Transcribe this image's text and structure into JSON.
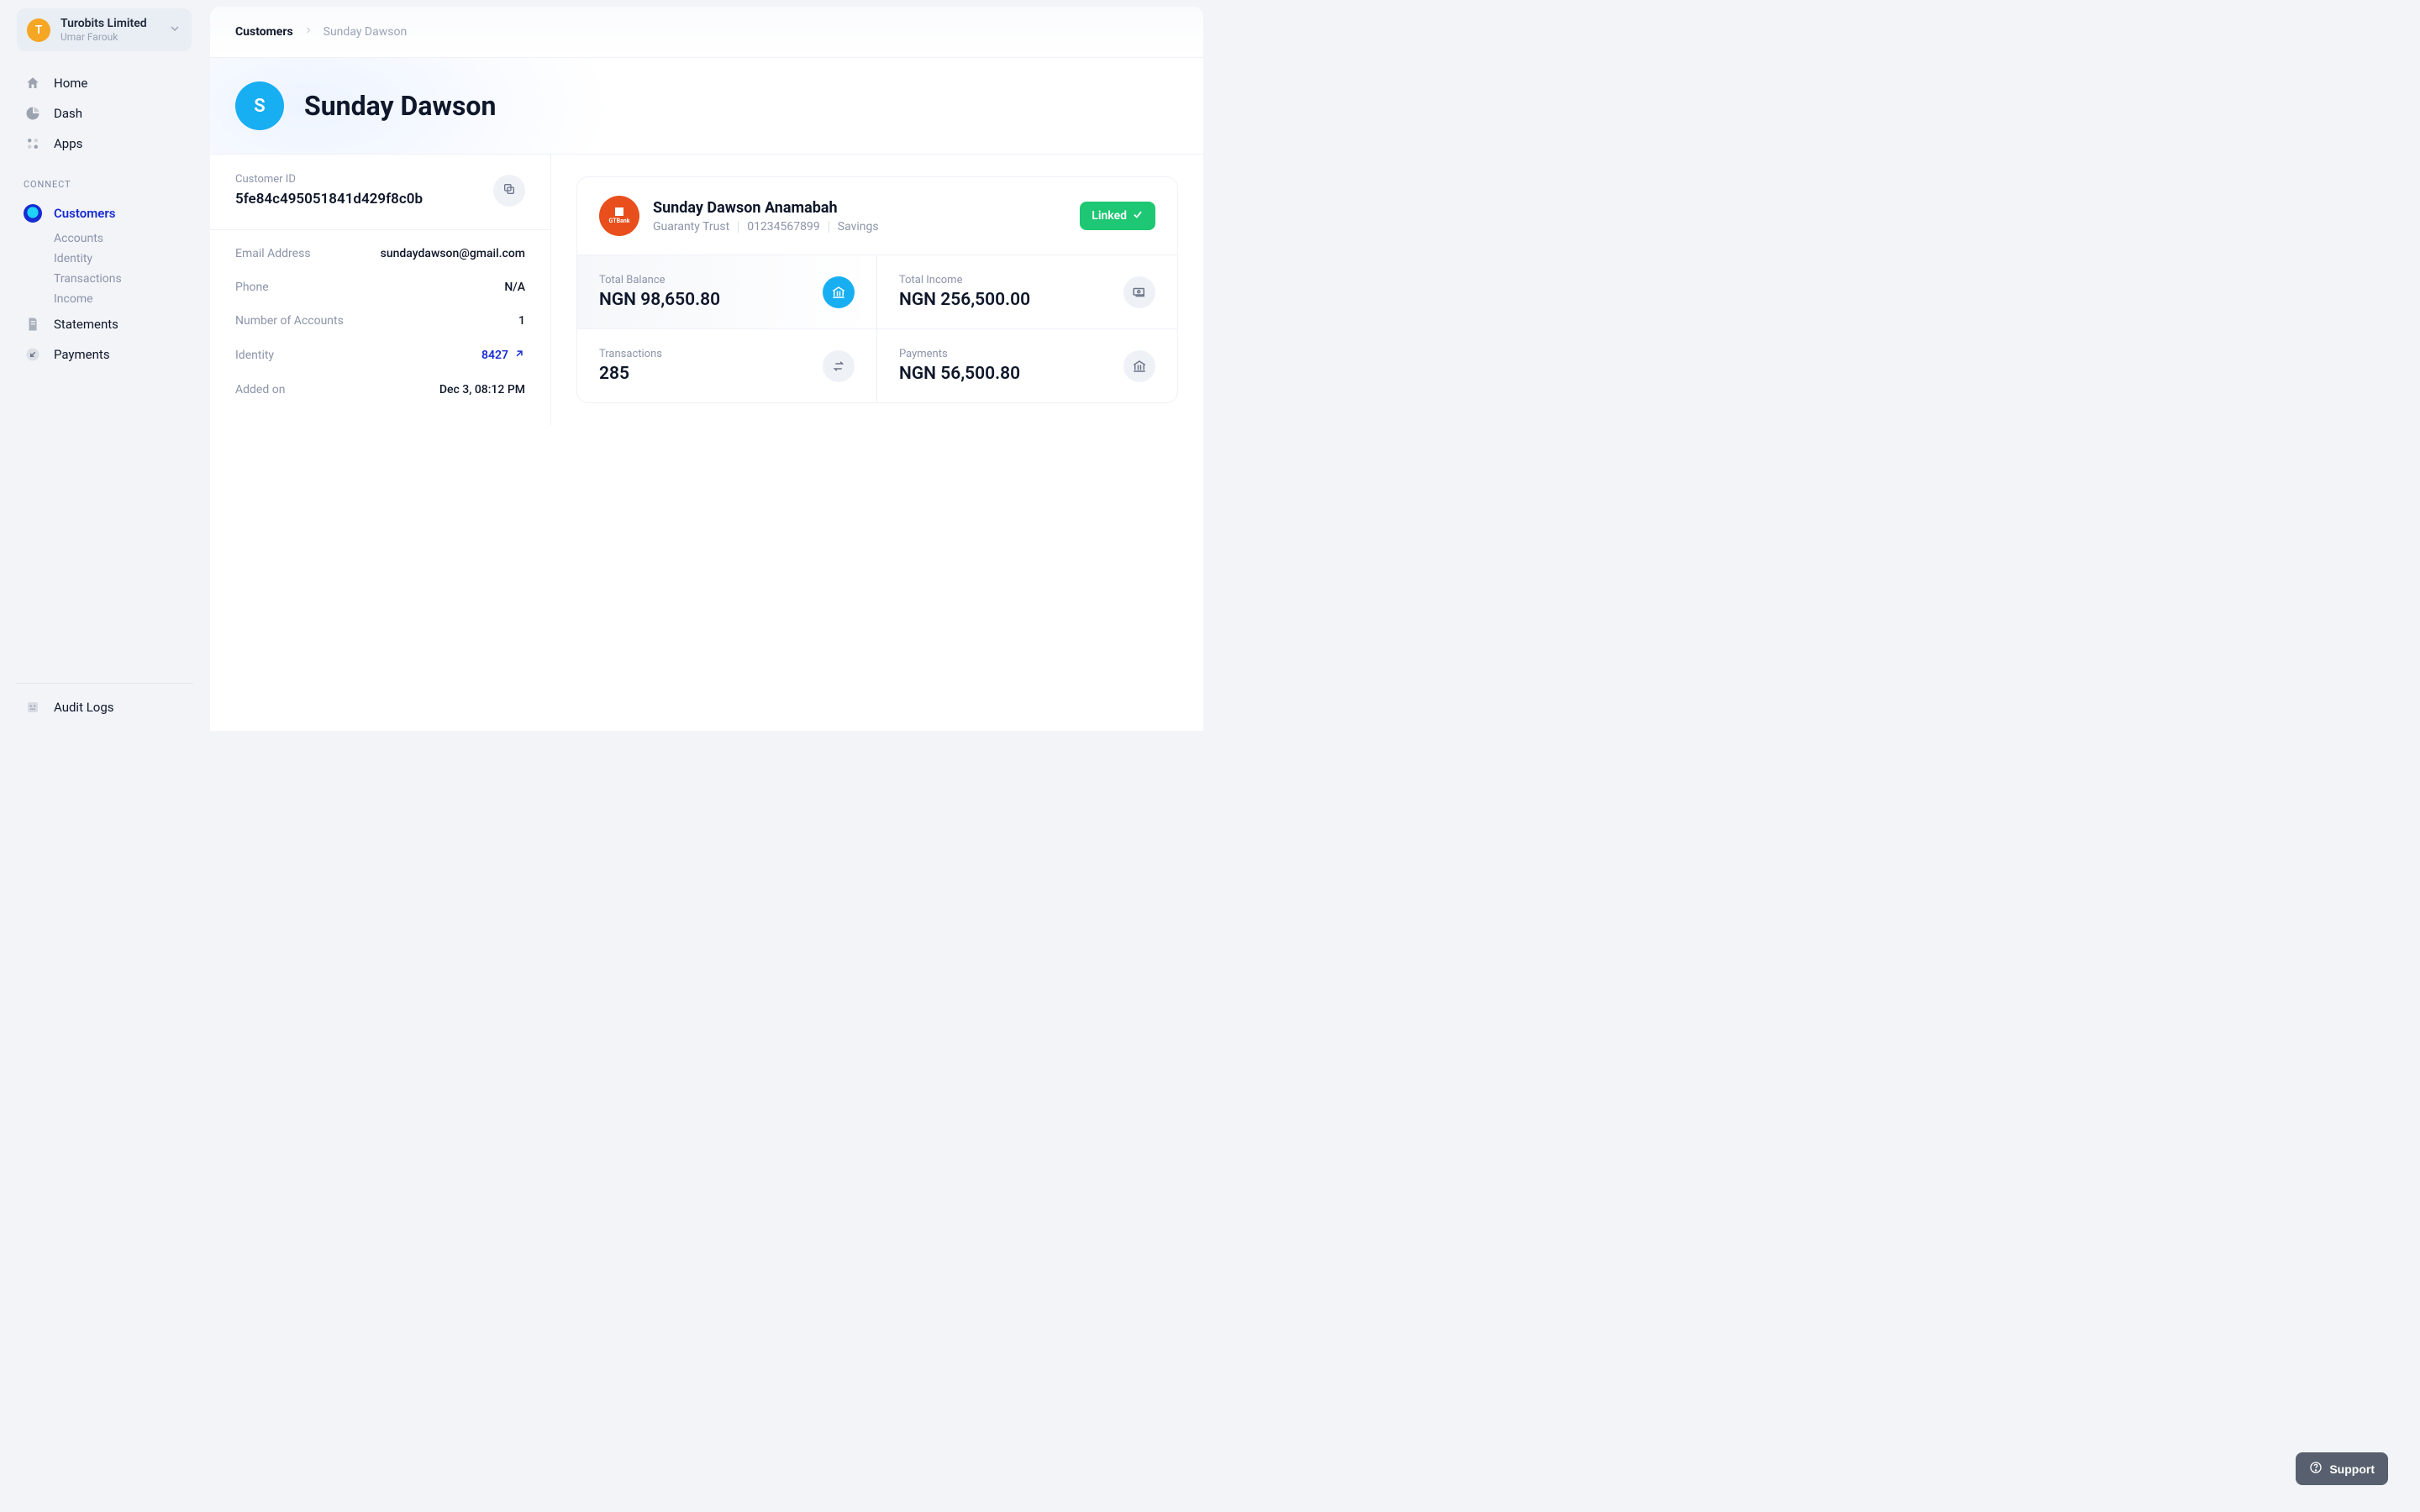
{
  "org": {
    "avatar_initial": "T",
    "name": "Turobits Limited",
    "user": "Umar Farouk"
  },
  "nav": {
    "home": "Home",
    "dash": "Dash",
    "apps": "Apps",
    "section_connect": "CONNECT",
    "customers": "Customers",
    "sub": {
      "accounts": "Accounts",
      "identity": "Identity",
      "transactions": "Transactions",
      "income": "Income"
    },
    "statements": "Statements",
    "payments": "Payments",
    "audit_logs": "Audit Logs"
  },
  "breadcrumb": {
    "root": "Customers",
    "current": "Sunday Dawson"
  },
  "customer": {
    "avatar_initial": "S",
    "name": "Sunday Dawson",
    "id_label": "Customer ID",
    "id_value": "5fe84c495051841d429f8c0b",
    "details": {
      "email_label": "Email Address",
      "email_value": "sundaydawson@gmail.com",
      "phone_label": "Phone",
      "phone_value": "N/A",
      "num_accounts_label": "Number of Accounts",
      "num_accounts_value": "1",
      "identity_label": "Identity",
      "identity_value": "8427",
      "added_label": "Added on",
      "added_value": "Dec 3, 08:12 PM"
    }
  },
  "account": {
    "bank_short": "GTBank",
    "holder": "Sunday Dawson Anamabah",
    "bank": "Guaranty Trust",
    "number": "01234567899",
    "type": "Savings",
    "linked_label": "Linked",
    "stats": {
      "balance_label": "Total Balance",
      "balance_value": "NGN 98,650.80",
      "income_label": "Total Income",
      "income_value": "NGN 256,500.00",
      "tx_label": "Transactions",
      "tx_value": "285",
      "payments_label": "Payments",
      "payments_value": "NGN 56,500.80"
    }
  },
  "support": {
    "label": "Support"
  }
}
